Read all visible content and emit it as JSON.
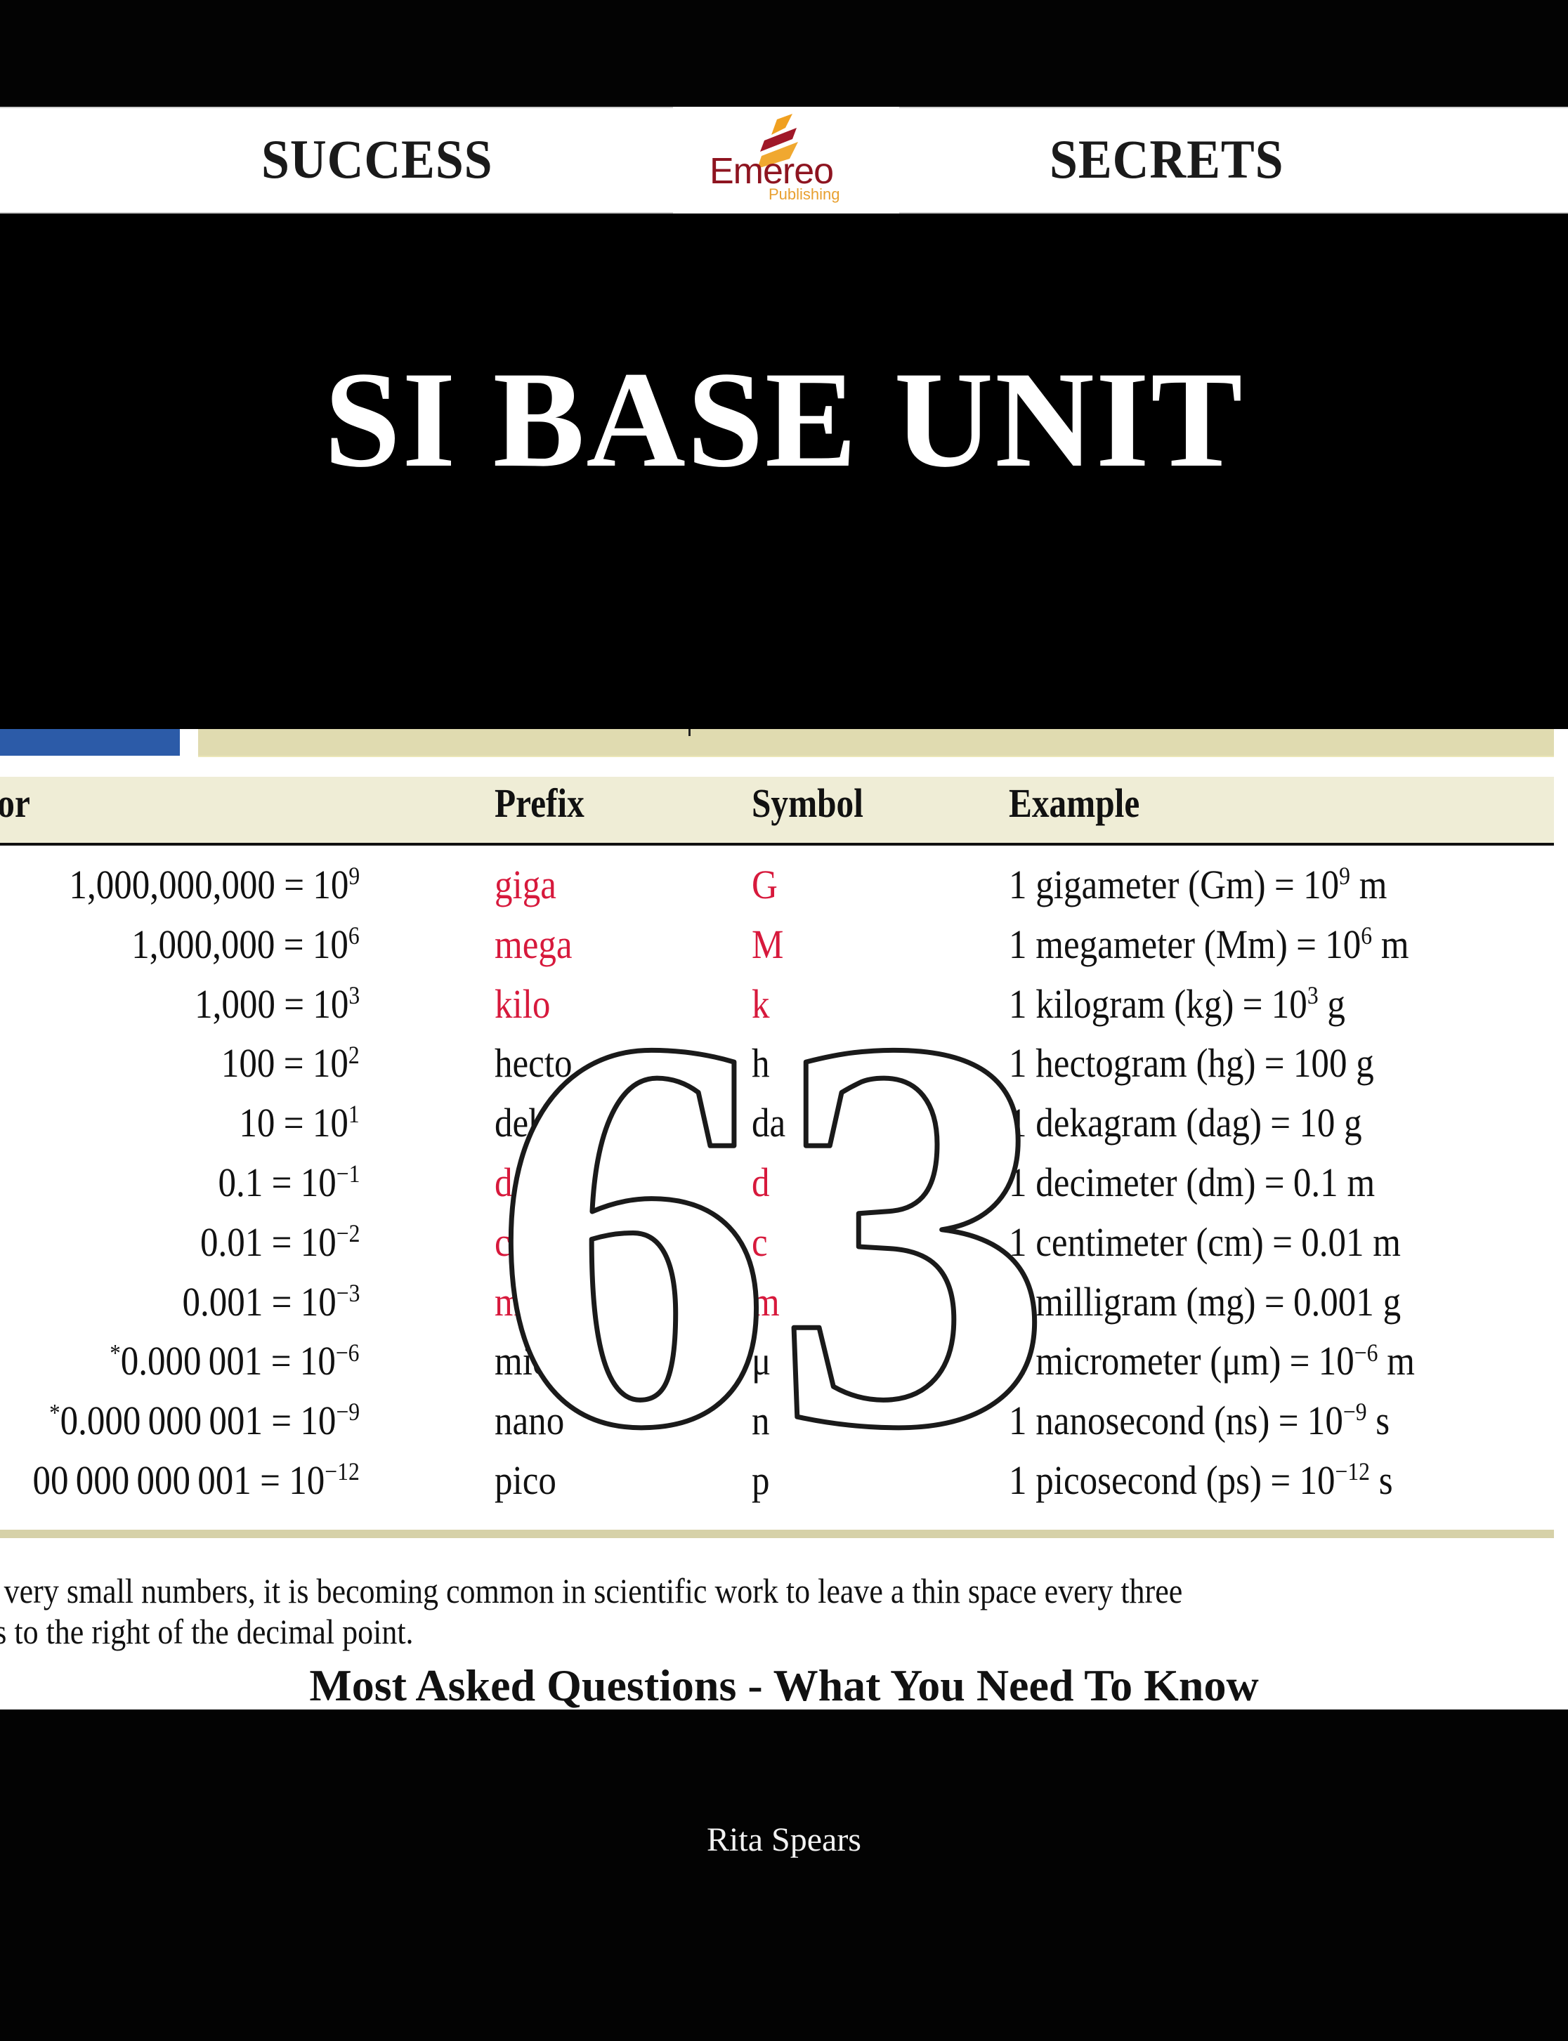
{
  "header": {
    "left_word": "SUCCESS",
    "right_word": "SECRETS",
    "logo": {
      "name": "Emereo",
      "sub": "Publishing",
      "icon": "flame-stripes-logo-icon"
    }
  },
  "title": "SI BASE UNIT",
  "table": {
    "headers": {
      "factor": "ctor",
      "prefix": "Prefix",
      "symbol": "Symbol",
      "example": "Example"
    },
    "rows": [
      {
        "factor": "1,000,000,000",
        "asterisk": "",
        "power": "9",
        "prefix": "giga",
        "symbol": "G",
        "highlight": true,
        "example_pre": "1 gigameter (Gm)",
        "example_val": "10",
        "example_exp": "9",
        "example_unit": "m"
      },
      {
        "factor": "1,000,000",
        "asterisk": "",
        "power": "6",
        "prefix": "mega",
        "symbol": "M",
        "highlight": true,
        "example_pre": "1 megameter (Mm)",
        "example_val": "10",
        "example_exp": "6",
        "example_unit": "m"
      },
      {
        "factor": "1,000",
        "asterisk": "",
        "power": "3",
        "prefix": "kilo",
        "symbol": "k",
        "highlight": true,
        "example_pre": "1 kilogram (kg)",
        "example_val": "10",
        "example_exp": "3",
        "example_unit": "g"
      },
      {
        "factor": "100",
        "asterisk": "",
        "power": "2",
        "prefix": "hecto",
        "symbol": "h",
        "highlight": false,
        "example_pre": "1 hectogram (hg)",
        "example_val": "100",
        "example_exp": "",
        "example_unit": "g"
      },
      {
        "factor": "10",
        "asterisk": "",
        "power": "1",
        "prefix": "deka",
        "symbol": "da",
        "highlight": false,
        "example_pre": "1 dekagram (dag)",
        "example_val": "10",
        "example_exp": "",
        "example_unit": "g"
      },
      {
        "factor": "0.1",
        "asterisk": "",
        "power": "−1",
        "prefix": "deci",
        "symbol": "d",
        "highlight": true,
        "example_pre": "1 decimeter (dm)",
        "example_val": "0.1",
        "example_exp": "",
        "example_unit": "m"
      },
      {
        "factor": "0.01",
        "asterisk": "",
        "power": "−2",
        "prefix": "centi",
        "symbol": "c",
        "highlight": true,
        "example_pre": "1 centimeter (cm)",
        "example_val": "0.01",
        "example_exp": "",
        "example_unit": "m"
      },
      {
        "factor": "0.001",
        "asterisk": "",
        "power": "−3",
        "prefix": "milli",
        "symbol": "m",
        "highlight": true,
        "example_pre": "1 milligram (mg)",
        "example_val": "0.001",
        "example_exp": "",
        "example_unit": "g"
      },
      {
        "factor": "0.000 001",
        "asterisk": "*",
        "power": "−6",
        "prefix": "micro",
        "symbol": "μ",
        "highlight": false,
        "example_pre": "1 micrometer (μm)",
        "example_val": "10",
        "example_exp": "−6",
        "example_unit": "m"
      },
      {
        "factor": "0.000 000 001",
        "asterisk": "*",
        "power": "−9",
        "prefix": "nano",
        "symbol": "n",
        "highlight": false,
        "example_pre": "1 nanosecond (ns)",
        "example_val": "10",
        "example_exp": "−9",
        "example_unit": "s"
      },
      {
        "factor": "00 000 000 001",
        "asterisk": "",
        "power": "−12",
        "prefix": "pico",
        "symbol": "p",
        "highlight": false,
        "example_pre": "1 picosecond (ps)",
        "example_val": "10",
        "example_exp": "−12",
        "example_unit": "s"
      }
    ]
  },
  "footnote": {
    "line1": "r very small numbers, it is becoming common in scientific work to leave a thin space every three",
    "line2": "ts to the right of the decimal point."
  },
  "subtitle": "Most Asked Questions - What You Need To Know",
  "overlay_number": "63",
  "author": "Rita Spears",
  "colors": {
    "highlight_red": "#d7193c",
    "blue_bar": "#2c5ba8",
    "tan_bar": "#e0dbb0",
    "header_row_bg": "#efedd6",
    "logo_red": "#8e1420",
    "logo_orange": "#e8a030"
  }
}
